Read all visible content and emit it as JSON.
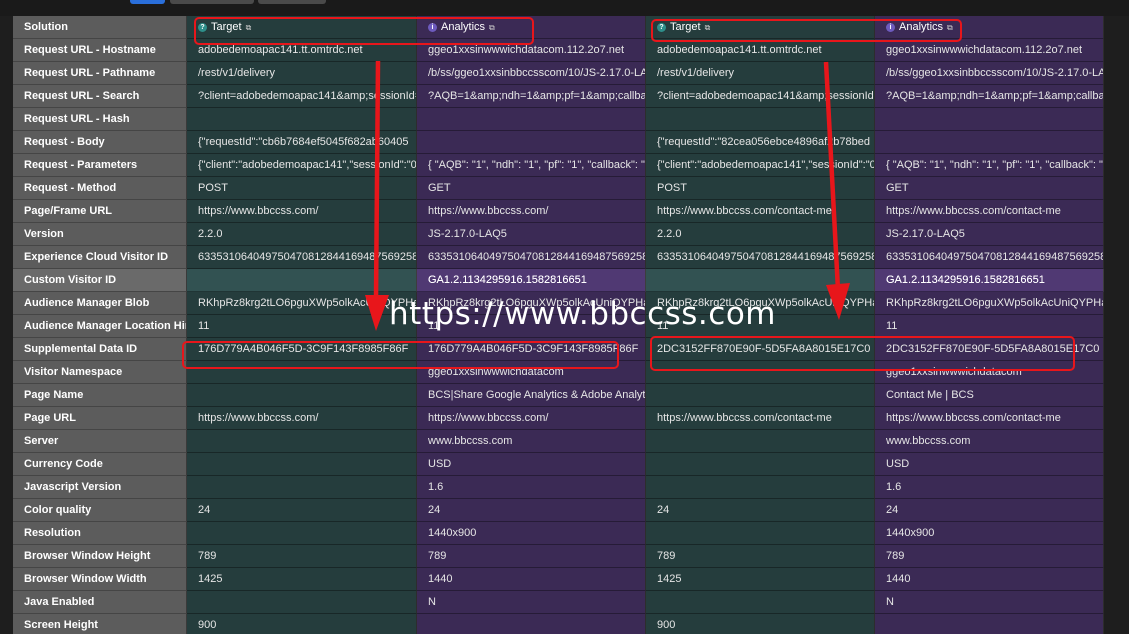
{
  "columns": [
    {
      "label": "Target",
      "solution": "target",
      "icon": "target-icon"
    },
    {
      "label": "Analytics",
      "solution": "analytics",
      "icon": "analytics-icon"
    },
    {
      "label": "Target",
      "solution": "target",
      "icon": "target-icon"
    },
    {
      "label": "Analytics",
      "solution": "analytics",
      "icon": "analytics-icon"
    }
  ],
  "header_label": "Solution",
  "rows": [
    {
      "label": "Request URL - Hostname",
      "values": [
        "adobedemoapac141.tt.omtrdc.net",
        "ggeo1xxsinwwwichdatacom.112.2o7.net",
        "adobedemoapac141.tt.omtrdc.net",
        "ggeo1xxsinwwwichdatacom.112.2o7.net"
      ]
    },
    {
      "label": "Request URL - Pathname",
      "values": [
        "/rest/v1/delivery",
        "/b/ss/ggeo1xxsinbbccsscom/10/JS-2.17.0-LAQ5",
        "/rest/v1/delivery",
        "/b/ss/ggeo1xxsinbbccsscom/10/JS-2.17.0-LAQ5"
      ]
    },
    {
      "label": "Request URL - Search",
      "values": [
        "?client=adobedemoapac141&amp;sessionId=",
        "?AQB=1&amp;ndh=1&amp;pf=1&amp;callback=",
        "?client=adobedemoapac141&amp;sessionId=",
        "?AQB=1&amp;ndh=1&amp;pf=1&amp;callback="
      ]
    },
    {
      "label": "Request URL - Hash",
      "values": [
        "",
        "",
        "",
        ""
      ]
    },
    {
      "label": "Request - Body",
      "values": [
        "{\"requestId\":\"cb6b7684ef5045f682ab60405",
        "",
        "{\"requestId\":\"82cea056ebce4896af2b78bed",
        ""
      ]
    },
    {
      "label": "Request - Parameters",
      "values": [
        "{\"client\":\"adobedemoapac141\",\"sessionId\":\"05",
        "{ \"AQB\": \"1\", \"ndh\": \"1\", \"pf\": \"1\", \"callback\": \"s_c",
        "{\"client\":\"adobedemoapac141\",\"sessionId\":\"05",
        "{ \"AQB\": \"1\", \"ndh\": \"1\", \"pf\": \"1\", \"callback\": \"s_c"
      ]
    },
    {
      "label": "Request - Method",
      "values": [
        "POST",
        "GET",
        "POST",
        "GET"
      ]
    },
    {
      "label": "Page/Frame URL",
      "values": [
        "https://www.bbccss.com/",
        "https://www.bbccss.com/",
        "https://www.bbccss.com/contact-me",
        "https://www.bbccss.com/contact-me"
      ]
    },
    {
      "label": "Version",
      "values": [
        "2.2.0",
        "JS-2.17.0-LAQ5",
        "2.2.0",
        "JS-2.17.0-LAQ5"
      ]
    },
    {
      "label": "Experience Cloud Visitor ID",
      "values": [
        "63353106404975047081284416948756925895",
        "63353106404975047081284416948756925895",
        "63353106404975047081284416948756925895",
        "63353106404975047081284416948756925895"
      ]
    },
    {
      "label": "Custom Visitor ID",
      "values": [
        "",
        "GA1.2.1134295916.1582816651",
        "",
        "GA1.2.1134295916.1582816651"
      ],
      "highlight": true
    },
    {
      "label": "Audience Manager Blob",
      "values": [
        "RKhpRz8krg2tLO6pguXWp5olkAcUniQYPHa",
        "RKhpRz8krg2tLO6pguXWp5olkAcUniQYPHa",
        "RKhpRz8krg2tLO6pguXWp5olkAcUniQYPHa",
        "RKhpRz8krg2tLO6pguXWp5olkAcUniQYPHa"
      ]
    },
    {
      "label": "Audience Manager Location Hint",
      "values": [
        "11",
        "11",
        "11",
        "11"
      ]
    },
    {
      "label": "Supplemental Data ID",
      "values": [
        "176D779A4B046F5D-3C9F143F8985F86F",
        "176D779A4B046F5D-3C9F143F8985F86F",
        "2DC3152FF870E90F-5D5FA8A8015E17C0",
        "2DC3152FF870E90F-5D5FA8A8015E17C0"
      ]
    },
    {
      "label": "Visitor Namespace",
      "values": [
        "",
        "ggeo1xxsinwwwichdatacom",
        "",
        "ggeo1xxsinwwwichdatacom"
      ]
    },
    {
      "label": "Page Name",
      "values": [
        "",
        "BCS|Share Google Analytics & Adobe Analytics",
        "",
        "Contact Me | BCS"
      ]
    },
    {
      "label": "Page URL",
      "values": [
        "https://www.bbccss.com/",
        "https://www.bbccss.com/",
        "https://www.bbccss.com/contact-me",
        "https://www.bbccss.com/contact-me"
      ]
    },
    {
      "label": "Server",
      "values": [
        "",
        "www.bbccss.com",
        "",
        "www.bbccss.com"
      ]
    },
    {
      "label": "Currency Code",
      "values": [
        "",
        "USD",
        "",
        "USD"
      ]
    },
    {
      "label": "Javascript Version",
      "values": [
        "",
        "1.6",
        "",
        "1.6"
      ]
    },
    {
      "label": "Color quality",
      "values": [
        "24",
        "24",
        "24",
        "24"
      ]
    },
    {
      "label": "Resolution",
      "values": [
        "",
        "1440x900",
        "",
        "1440x900"
      ]
    },
    {
      "label": "Browser Window Height",
      "values": [
        "789",
        "789",
        "789",
        "789"
      ]
    },
    {
      "label": "Browser Window Width",
      "values": [
        "1425",
        "1440",
        "1425",
        "1440"
      ]
    },
    {
      "label": "Java Enabled",
      "values": [
        "",
        "N",
        "",
        "N"
      ]
    },
    {
      "label": "Screen Height",
      "values": [
        "900",
        "",
        "900",
        ""
      ]
    }
  ],
  "watermark": "https://www.bbccss.com",
  "colors": {
    "target_bg": "#253d3d",
    "analytics_bg": "#3b2a55",
    "label_bg": "#5c5c5c",
    "highlight": "#e8161b",
    "accent": "#2a6fdb"
  }
}
